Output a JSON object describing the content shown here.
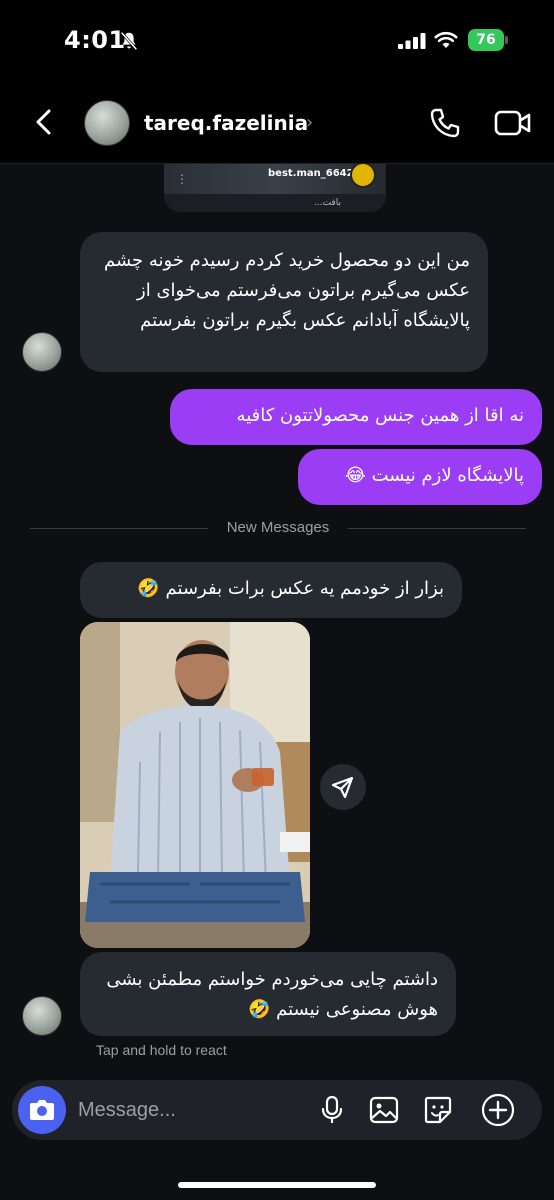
{
  "status_bar": {
    "time": "4:01",
    "battery": "76"
  },
  "header": {
    "username": "tareq.fazelinia",
    "chevron": "›"
  },
  "shared_post": {
    "dots": "⋮",
    "user": "best.man_6642",
    "caption": "...بافت"
  },
  "messages": {
    "m1": "من این دو محصول خرید کردم رسیدم خونه چشم عکس می‌گیرم براتون می‌فرستم می‌خوای از پالایشگاه آبادانم عکس بگیرم براتون بفرستم",
    "m2": "نه اقا از همین جنس محصولاتتون کافیه",
    "m3": "پالایشگاه لازم نیست 😂",
    "divider": "New Messages",
    "m4": "بزار از خودمم یه عکس برات بفرستم 🤣",
    "m5": "داشتم چایی می‌خوردم خواستم مطمئن بشی هوش مصنوعی نیستم 🤣",
    "tap_hint": "Tap and hold to react"
  },
  "composer": {
    "placeholder": "Message..."
  },
  "colors": {
    "outgoing_bubble": "#9b3df5",
    "incoming_bubble": "#262a31",
    "camera_button": "#4b62f0",
    "battery": "#34c759"
  },
  "icons": [
    "back-icon",
    "call-icon",
    "video-icon",
    "share-icon",
    "camera-icon",
    "mic-icon",
    "gallery-icon",
    "sticker-icon",
    "plus-icon",
    "bell-off-icon",
    "signal-icon",
    "wifi-icon"
  ]
}
